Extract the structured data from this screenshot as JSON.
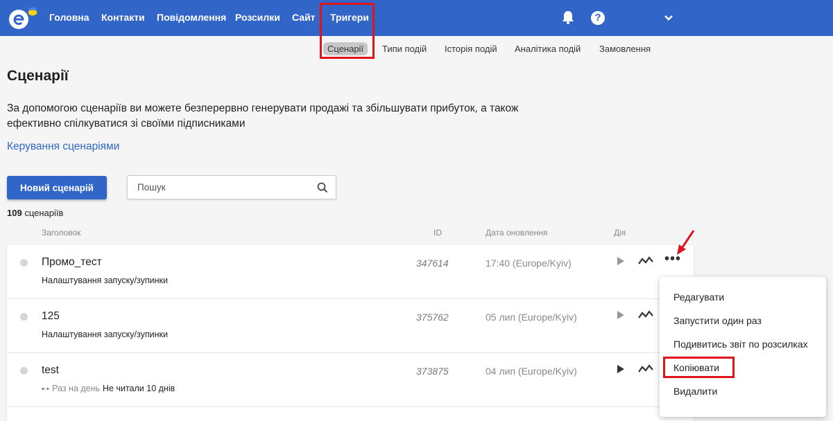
{
  "topnav": {
    "items": [
      "Головна",
      "Контакти",
      "Повідомлення",
      "Розсилки",
      "Сайт",
      "Тригери"
    ]
  },
  "subnav": {
    "items": [
      "Сценарії",
      "Типи подій",
      "Історія подій",
      "Аналітика подій",
      "Замовлення"
    ]
  },
  "page": {
    "title": "Сценарії",
    "description": "За допомогою сценаріїв ви можете безперервно генерувати продажі та збільшувати прибуток, а також ефективно спілкуватися зі своїми підписниками",
    "manage_link": "Керування сценаріями"
  },
  "toolbar": {
    "new_button": "Новий сценарій",
    "search_placeholder": "Пошук"
  },
  "count": {
    "number": "109",
    "label": "сценаріїв"
  },
  "columns": [
    "Заголовок",
    "ID",
    "Дата оновлення",
    "Дія"
  ],
  "rows": [
    {
      "title": "Промо_тест",
      "subtitle": "Налаштування запуску/зупинки",
      "id": "347614",
      "date": "17:40 (Europe/Kyiv)"
    },
    {
      "title": "125",
      "subtitle": "Налаштування запуску/зупинки",
      "id": "375762",
      "date": "05 лип (Europe/Kyiv)"
    },
    {
      "title": "test",
      "sub_muted": "Раз на день",
      "sub_text": "Не читали 10 днів",
      "id": "373875",
      "date": "04 лип (Europe/Kyiv)"
    }
  ],
  "menu": {
    "items": [
      "Редагувати",
      "Запустити один раз",
      "Подивитись звіт по розсилках",
      "Копіювати",
      "Видалити"
    ]
  },
  "colors": {
    "brand": "#3166c8",
    "highlight": "#e0141b"
  }
}
